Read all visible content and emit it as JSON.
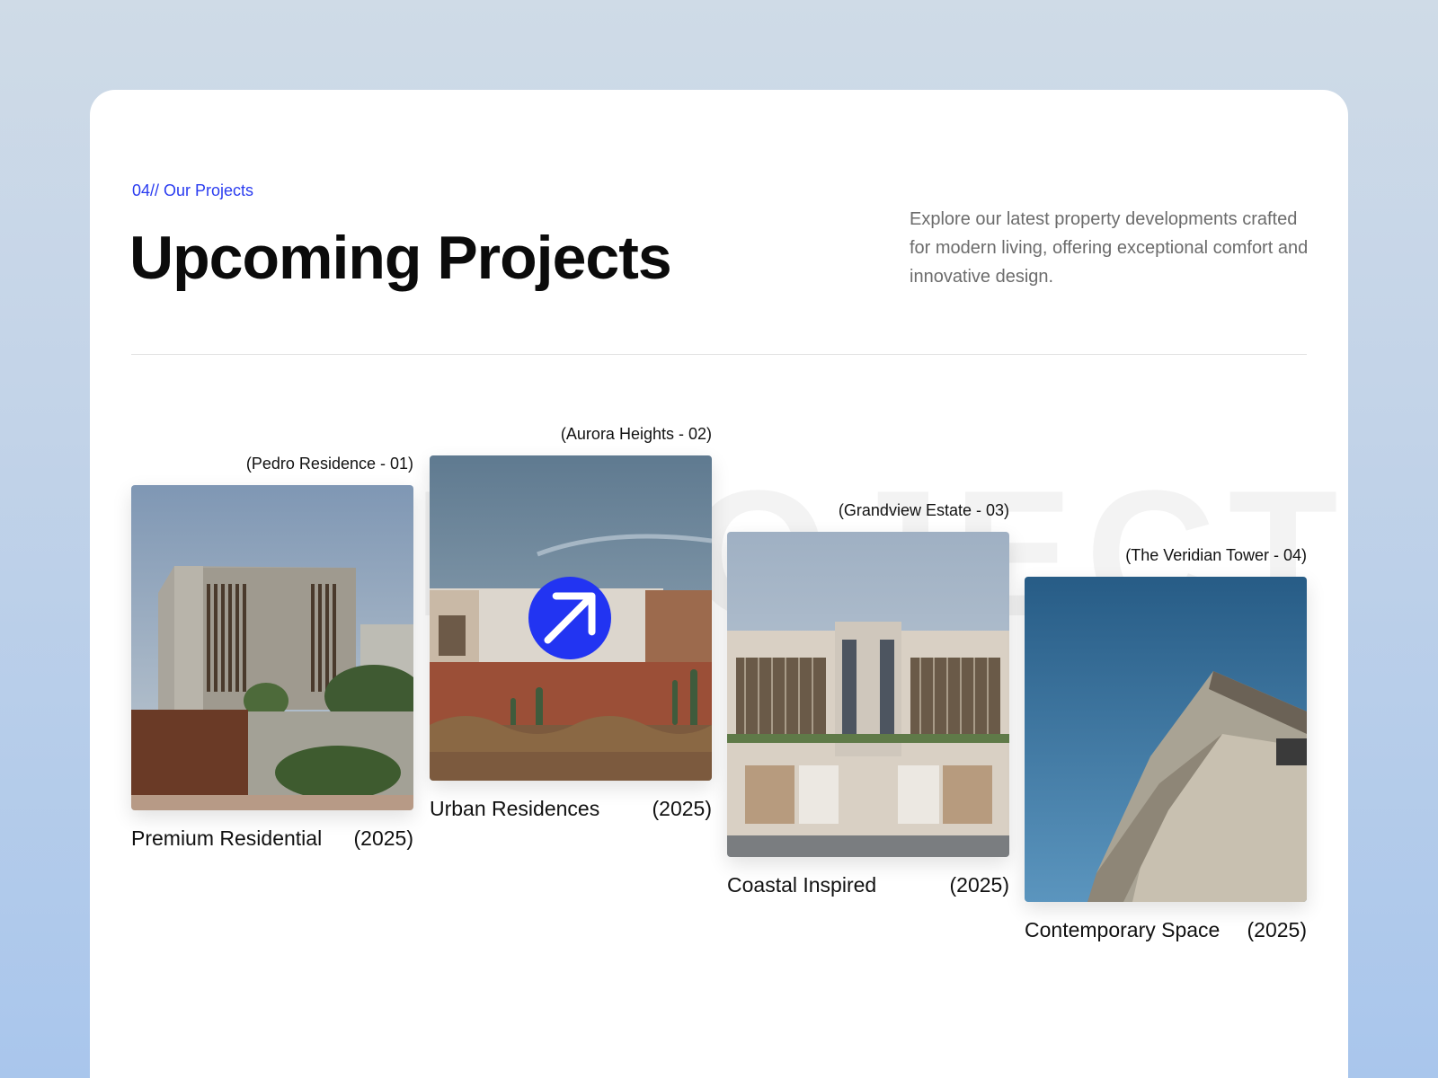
{
  "section": {
    "eyebrow": "04// Our Projects",
    "title": "Upcoming Projects",
    "description": "Explore our latest property developments crafted for modern living, offering exceptional comfort and innovative design.",
    "watermark": "PROJECTS"
  },
  "projects": [
    {
      "code": "(Pedro Residence - 01)",
      "name": "Premium Residential",
      "year": "(2025)"
    },
    {
      "code": "(Aurora Heights - 02)",
      "name": "Urban Residences",
      "year": "(2025)",
      "action_icon": "arrow-up-right-icon"
    },
    {
      "code": "(Grandview Estate - 03)",
      "name": "Coastal Inspired",
      "year": "(2025)"
    },
    {
      "code": "(The Veridian Tower - 04)",
      "name": "Contemporary Space",
      "year": "(2025)"
    }
  ],
  "colors": {
    "accent": "#2234f2",
    "eyebrow": "#2a3cf0",
    "title": "#0b0b0b",
    "body_text": "#6c6c6c"
  }
}
